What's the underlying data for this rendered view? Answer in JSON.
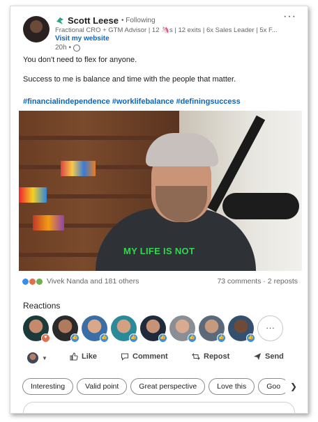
{
  "author": {
    "name": "Scott Leese",
    "following": "• Following",
    "headline": "Fractional CRO + GTM Advisor | 12 🦄s | 12 exits | 6x Sales Leader | 5x F...",
    "website_link": "Visit my website",
    "time": "20h •",
    "more": "···"
  },
  "post": {
    "line1": "You don't need to flex for anyone.",
    "line2": "Success to me is balance and time with the people that matter.",
    "hashtags": "#financialindependence #worklifebalance #definingsuccess"
  },
  "video": {
    "caption": "MY LIFE IS NOT"
  },
  "social": {
    "reactors": "Vivek Nanda and 181 others",
    "comments_reposts": "73 comments · 2 reposts"
  },
  "reactions": {
    "label": "Reactions",
    "more": "···"
  },
  "actions": {
    "like": "Like",
    "comment": "Comment",
    "repost": "Repost",
    "send": "Send"
  },
  "chips": [
    "Interesting",
    "Valid point",
    "Great perspective",
    "Love this",
    "Goo"
  ],
  "colors": {
    "link_blue": "#0a66c2",
    "caption_green": "#39d353",
    "like_blue": "#378fe9",
    "love_red": "#df704d"
  }
}
